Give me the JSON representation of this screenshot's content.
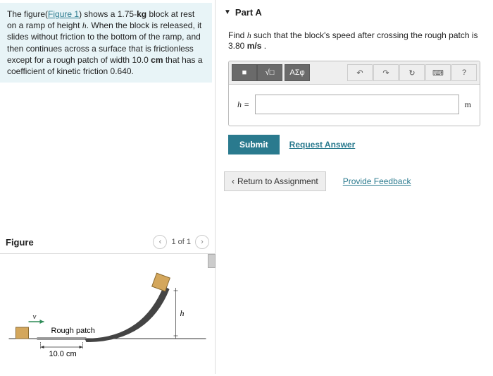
{
  "problem": {
    "pre": "The figure(",
    "fig_link": "Figure 1",
    "post1": ") shows a 1.75-",
    "kg": "kg",
    "post2": " block at rest on a ramp of height ",
    "hvar": "h",
    "post3": ". When the block is released, it slides without friction to the bottom of the ramp, and then continues across a surface that is frictionless except for a rough patch of width 10.0 ",
    "cm": "cm",
    "post4": " that has a coefficient of kinetic friction 0.640."
  },
  "figure": {
    "title": "Figure",
    "counter": "1 of 1",
    "rough_label": "Rough patch",
    "height_label": "h",
    "width_label": "10.0 cm",
    "v_label": "v⃗"
  },
  "part": {
    "label": "Part A",
    "prompt_pre": "Find ",
    "prompt_h": "h",
    "prompt_mid": " such that the block's speed after crossing the rough patch is 3.80 ",
    "prompt_unit": "m/s",
    "prompt_end": " ."
  },
  "toolbar": {
    "templates": "■",
    "sqrt": "√□",
    "greek": "ΑΣφ",
    "undo": "↶",
    "redo": "↷",
    "reset": "↻",
    "keyboard": "⌨",
    "help": "?"
  },
  "input": {
    "label": "h =",
    "unit": "m"
  },
  "actions": {
    "submit": "Submit",
    "request": "Request Answer",
    "return": "Return to Assignment",
    "feedback": "Provide Feedback"
  }
}
